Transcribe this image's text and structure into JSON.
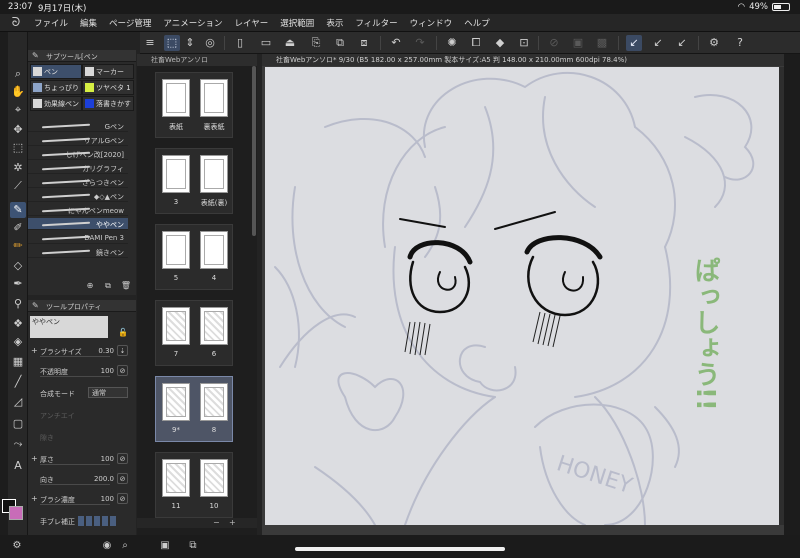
{
  "status": {
    "time": "23:07",
    "date": "9月17日(木)",
    "battery": "49%",
    "battery_level": 0.49
  },
  "menu": [
    "ファイル",
    "編集",
    "ページ管理",
    "アニメーション",
    "レイヤー",
    "選択範囲",
    "表示",
    "フィルター",
    "ウィンドウ",
    "ヘルプ"
  ],
  "subtool": {
    "title": "サブツール[ペン",
    "tabs": [
      {
        "label": "ペン",
        "active": true,
        "swatch": "#d8d8d8"
      },
      {
        "label": "マーカー",
        "active": false,
        "swatch": "#d8d8d8"
      },
      {
        "label": "ちょっぴり",
        "active": false,
        "swatch": "#8da4c8"
      },
      {
        "label": "ツヤベタ 1",
        "active": false,
        "swatch": "#d6ef43"
      },
      {
        "label": "効果線ペン",
        "active": false,
        "swatch": "#d8d8d8"
      },
      {
        "label": "落書きかす",
        "active": false,
        "swatch": "#1c3fd8"
      }
    ],
    "brushes": [
      "Gペン",
      "リアルGペン",
      "しげペン改[2020]",
      "カリグラフィ",
      "ざらつきペン",
      "◆◇▲ペン",
      "にゃんペンmeow",
      "ややペン",
      "DAMI Pen 3",
      "鏡きペン"
    ],
    "active_brush": 7
  },
  "toolprop": {
    "title": "ツールプロパティ",
    "name": "ややペン",
    "brush_size_label": "ブラシサイズ",
    "brush_size": "0.30",
    "opacity_label": "不透明度",
    "opacity": "100",
    "blend_label": "合成モード",
    "blend": "通常",
    "aa_label": "アンチエイ",
    "stab_label": "隙き",
    "thickness_label": "厚さ",
    "thickness": "100",
    "direction_label": "向き",
    "direction": "200.0",
    "density_label": "ブラシ濃度",
    "density": "100",
    "correction_label": "手ブレ補正"
  },
  "pages": {
    "title": "社畜Webアンソロ",
    "items": [
      "表紙",
      "裏表紙",
      "3",
      "表紙(裏)",
      "5",
      "4",
      "7",
      "6",
      "9*",
      "8",
      "11",
      "10"
    ],
    "selected_spread": 4
  },
  "canvas": {
    "tab_title": "社畜Webアンソロ* 9/30 (B5 182.00 x 257.00mm 製本サイズ:A5 判 148.00 x 210.00mm 600dpi 78.4%)",
    "jar_text": "HONEY",
    "sfx_text": "ぱっしょう!!",
    "sfx_color": "#8ab87a"
  },
  "colors": {
    "main": "#111111",
    "sub": "#c86cb8"
  }
}
